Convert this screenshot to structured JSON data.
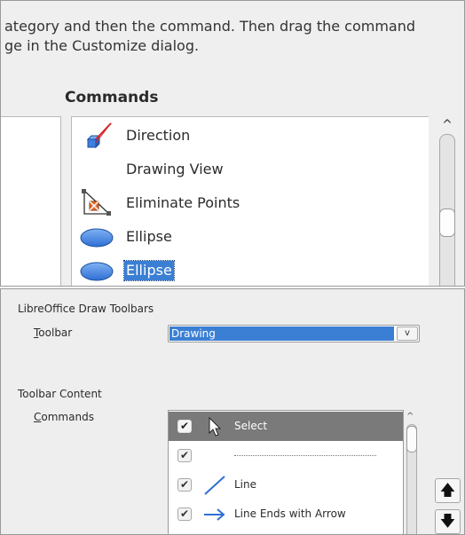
{
  "top": {
    "instruction_line1": "ategory and then the command. Then drag the command",
    "instruction_line2": "ge in the Customize dialog.",
    "commands_heading": "Commands",
    "commands": [
      {
        "label": "Direction",
        "icon": "direction-icon"
      },
      {
        "label": "Drawing View",
        "icon": ""
      },
      {
        "label": "Eliminate Points",
        "icon": "eliminate-points-icon"
      },
      {
        "label": "Ellipse",
        "icon": "ellipse-icon"
      },
      {
        "label": "Ellipse",
        "icon": "ellipse-icon",
        "selected": true
      }
    ],
    "scroll_up_glyph": "^"
  },
  "bottom": {
    "group1_label": "LibreOffice Draw Toolbars",
    "toolbar_label_accel": "T",
    "toolbar_label_rest": "oolbar",
    "toolbar_value": "Drawing",
    "dropdown_glyph": "v",
    "group2_label": "Toolbar Content",
    "commands_label_accel": "C",
    "commands_label_rest": "ommands",
    "items": [
      {
        "label": "Select",
        "checked": true,
        "selected": true,
        "icon": "pointer-icon"
      },
      {
        "label": "",
        "checked": true,
        "separator": true
      },
      {
        "label": "Line",
        "checked": true,
        "icon": "line-icon"
      },
      {
        "label": "Line Ends with Arrow",
        "checked": true,
        "icon": "arrow-icon"
      }
    ],
    "check_glyph": "✔",
    "move_up_glyph": "🡅",
    "move_down_glyph": "🡇"
  },
  "colors": {
    "selection": "#3b7fd4",
    "panel_bg": "#efefef",
    "selected_row_bg": "#7a7a7a",
    "icon_blue": "#2f6fd6"
  }
}
